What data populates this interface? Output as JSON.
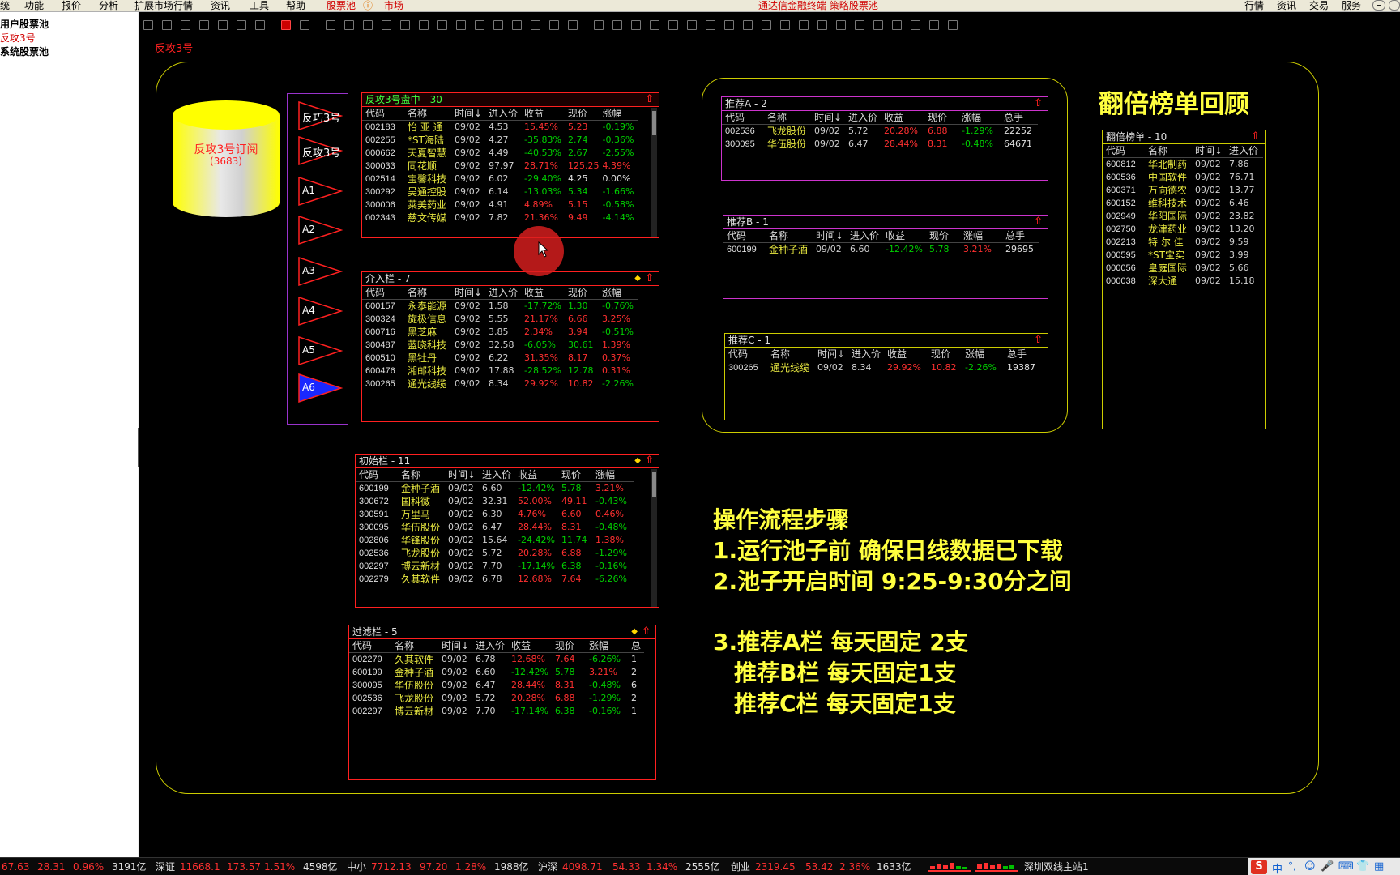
{
  "menu": {
    "items": [
      "统",
      "功能",
      "报价",
      "分析",
      "扩展市场行情",
      "资讯",
      "工具",
      "帮助"
    ],
    "active_tabs": [
      "股票池",
      "市场"
    ],
    "center_title": "通达信金融终端  策略股票池",
    "right_items": [
      "行情",
      "资讯",
      "交易",
      "服务"
    ]
  },
  "sidebar": {
    "items": [
      {
        "label": "用户股票池",
        "active": false
      },
      {
        "label": "反攻3号",
        "active": true
      },
      {
        "label": "系统股票池",
        "active": false
      }
    ]
  },
  "tab_title": "反攻3号",
  "subscription": {
    "label": "反攻3号订阅",
    "count": "(3683)"
  },
  "nav_buttons": [
    "反巧3号",
    "反攻3号",
    "A1",
    "A2",
    "A3",
    "A4",
    "A5",
    "A6"
  ],
  "colors": {
    "accent_yellow": "#ffff40",
    "frame": "#cccc00",
    "red": "#ff3030",
    "green": "#00d000",
    "purple": "#cc33cc",
    "nav_border": "#9933cc"
  },
  "panels": {
    "intraday": {
      "title": "反攻3号盘中 - 30",
      "columns": [
        "代码",
        "名称",
        "时间↓",
        "进入价",
        "收益",
        "现价",
        "涨幅"
      ],
      "rows": [
        [
          "002183",
          "怡 亚 通",
          "09/02",
          "4.53",
          "15.45%",
          "5.23",
          "-0.19%"
        ],
        [
          "002255",
          "*ST海陆",
          "09/02",
          "4.27",
          "-35.83%",
          "2.74",
          "-0.36%"
        ],
        [
          "000662",
          "天夏智慧",
          "09/02",
          "4.49",
          "-40.53%",
          "2.67",
          "-2.55%"
        ],
        [
          "300033",
          "同花顺",
          "09/02",
          "97.97",
          "28.71%",
          "125.25",
          "4.39%"
        ],
        [
          "002514",
          "宝馨科技",
          "09/02",
          "6.02",
          "-29.40%",
          "4.25",
          "0.00%"
        ],
        [
          "300292",
          "吴通控股",
          "09/02",
          "6.14",
          "-13.03%",
          "5.34",
          "-1.66%"
        ],
        [
          "300006",
          "莱美药业",
          "09/02",
          "4.91",
          "4.89%",
          "5.15",
          "-0.58%"
        ],
        [
          "002343",
          "慈文传媒",
          "09/02",
          "7.82",
          "21.36%",
          "9.49",
          "-4.14%"
        ]
      ]
    },
    "intervene": {
      "title": "介入栏 - 7",
      "columns": [
        "代码",
        "名称",
        "时间↓",
        "进入价",
        "收益",
        "现价",
        "涨幅"
      ],
      "rows": [
        [
          "600157",
          "永泰能源",
          "09/02",
          "1.58",
          "-17.72%",
          "1.30",
          "-0.76%"
        ],
        [
          "300324",
          "旋极信息",
          "09/02",
          "5.55",
          "21.17%",
          "6.66",
          "3.25%"
        ],
        [
          "000716",
          "黑芝麻",
          "09/02",
          "3.85",
          "2.34%",
          "3.94",
          "-0.51%"
        ],
        [
          "300487",
          "蓝晓科技",
          "09/02",
          "32.58",
          "-6.05%",
          "30.61",
          "1.39%"
        ],
        [
          "600510",
          "黑牡丹",
          "09/02",
          "6.22",
          "31.35%",
          "8.17",
          "0.37%"
        ],
        [
          "600476",
          "湘邮科技",
          "09/02",
          "17.88",
          "-28.52%",
          "12.78",
          "0.31%"
        ],
        [
          "300265",
          "通光线缆",
          "09/02",
          "8.34",
          "29.92%",
          "10.82",
          "-2.26%"
        ]
      ]
    },
    "initial": {
      "title": "初始栏 - 11",
      "columns": [
        "代码",
        "名称",
        "时间↓",
        "进入价",
        "收益",
        "现价",
        "涨幅"
      ],
      "rows": [
        [
          "600199",
          "金种子酒",
          "09/02",
          "6.60",
          "-12.42%",
          "5.78",
          "3.21%"
        ],
        [
          "300672",
          "国科微",
          "09/02",
          "32.31",
          "52.00%",
          "49.11",
          "-0.43%"
        ],
        [
          "300591",
          "万里马",
          "09/02",
          "6.30",
          "4.76%",
          "6.60",
          "0.46%"
        ],
        [
          "300095",
          "华伍股份",
          "09/02",
          "6.47",
          "28.44%",
          "8.31",
          "-0.48%"
        ],
        [
          "002806",
          "华锋股份",
          "09/02",
          "15.64",
          "-24.42%",
          "11.74",
          "1.38%"
        ],
        [
          "002536",
          "飞龙股份",
          "09/02",
          "5.72",
          "20.28%",
          "6.88",
          "-1.29%"
        ],
        [
          "002297",
          "博云新材",
          "09/02",
          "7.70",
          "-17.14%",
          "6.38",
          "-0.16%"
        ],
        [
          "002279",
          "久其软件",
          "09/02",
          "6.78",
          "12.68%",
          "7.64",
          "-6.26%"
        ]
      ]
    },
    "filter": {
      "title": "过滤栏 - 5",
      "columns": [
        "代码",
        "名称",
        "时间↓",
        "进入价",
        "收益",
        "现价",
        "涨幅",
        "总"
      ],
      "rows": [
        [
          "002279",
          "久其软件",
          "09/02",
          "6.78",
          "12.68%",
          "7.64",
          "-6.26%",
          "1"
        ],
        [
          "600199",
          "金种子酒",
          "09/02",
          "6.60",
          "-12.42%",
          "5.78",
          "3.21%",
          "2"
        ],
        [
          "300095",
          "华伍股份",
          "09/02",
          "6.47",
          "28.44%",
          "8.31",
          "-0.48%",
          "6"
        ],
        [
          "002536",
          "飞龙股份",
          "09/02",
          "5.72",
          "20.28%",
          "6.88",
          "-1.29%",
          "2"
        ],
        [
          "002297",
          "博云新材",
          "09/02",
          "7.70",
          "-17.14%",
          "6.38",
          "-0.16%",
          "1"
        ]
      ]
    },
    "recA": {
      "title": "推荐A - 2",
      "columns": [
        "代码",
        "名称",
        "时间↓",
        "进入价",
        "收益",
        "现价",
        "涨幅",
        "总手"
      ],
      "rows": [
        [
          "002536",
          "飞龙股份",
          "09/02",
          "5.72",
          "20.28%",
          "6.88",
          "-1.29%",
          "22252"
        ],
        [
          "300095",
          "华伍股份",
          "09/02",
          "6.47",
          "28.44%",
          "8.31",
          "-0.48%",
          "64671"
        ]
      ]
    },
    "recB": {
      "title": "推荐B - 1",
      "columns": [
        "代码",
        "名称",
        "时间↓",
        "进入价",
        "收益",
        "现价",
        "涨幅",
        "总手"
      ],
      "rows": [
        [
          "600199",
          "金种子酒",
          "09/02",
          "6.60",
          "-12.42%",
          "5.78",
          "3.21%",
          "29695"
        ]
      ]
    },
    "recC": {
      "title": "推荐C - 1",
      "columns": [
        "代码",
        "名称",
        "时间↓",
        "进入价",
        "收益",
        "现价",
        "涨幅",
        "总手"
      ],
      "rows": [
        [
          "300265",
          "通光线缆",
          "09/02",
          "8.34",
          "29.92%",
          "10.82",
          "-2.26%",
          "19387"
        ]
      ]
    },
    "double": {
      "title": "翻倍榜单 - 10",
      "columns": [
        "代码",
        "名称",
        "时间↓",
        "进入价"
      ],
      "rows": [
        [
          "600812",
          "华北制药",
          "09/02",
          "7.86"
        ],
        [
          "600536",
          "中国软件",
          "09/02",
          "76.71"
        ],
        [
          "600371",
          "万向德农",
          "09/02",
          "13.77"
        ],
        [
          "600152",
          "维科技术",
          "09/02",
          "6.46"
        ],
        [
          "002949",
          "华阳国际",
          "09/02",
          "23.82"
        ],
        [
          "002750",
          "龙津药业",
          "09/02",
          "13.20"
        ],
        [
          "002213",
          "特 尔 佳",
          "09/02",
          "9.59"
        ],
        [
          "000595",
          "*ST宝实",
          "09/02",
          "3.99"
        ],
        [
          "000056",
          "皇庭国际",
          "09/02",
          "5.66"
        ],
        [
          "000038",
          "深大通",
          "09/02",
          "15.18"
        ]
      ]
    }
  },
  "review_title": "翻倍榜单回顾",
  "steps": [
    "操作流程步骤",
    "1.运行池子前 确保日线数据已下载",
    "2.池子开启时间 9:25-9:30分之间",
    "3.推荐A栏 每天固定 2支",
    "推荐B栏 每天固定1支",
    "推荐C栏 每天固定1支"
  ],
  "status": {
    "s0": "67.63",
    "s1": "28.31",
    "s2": "0.96%",
    "s3": "3191亿",
    "sz_label": "深证",
    "sz_val": "11668.1",
    "sz_chg": "173.57",
    "sz_pct": "1.51%",
    "sz_amt": "4598亿",
    "zx_label": "中小",
    "zx_val": "7712.13",
    "zx_chg": "97.20",
    "zx_pct": "1.28%",
    "zx_amt": "1988亿",
    "hs_label": "沪深",
    "hs_val": "4098.71",
    "hs_chg": "54.33",
    "hs_pct": "1.34%",
    "hs_amt": "2555亿",
    "cy_label": "创业",
    "cy_val": "2319.45",
    "cy_chg": "53.42",
    "cy_pct": "2.36%",
    "cy_amt": "1633亿",
    "server": "深圳双线主站1",
    "tray": "中"
  }
}
